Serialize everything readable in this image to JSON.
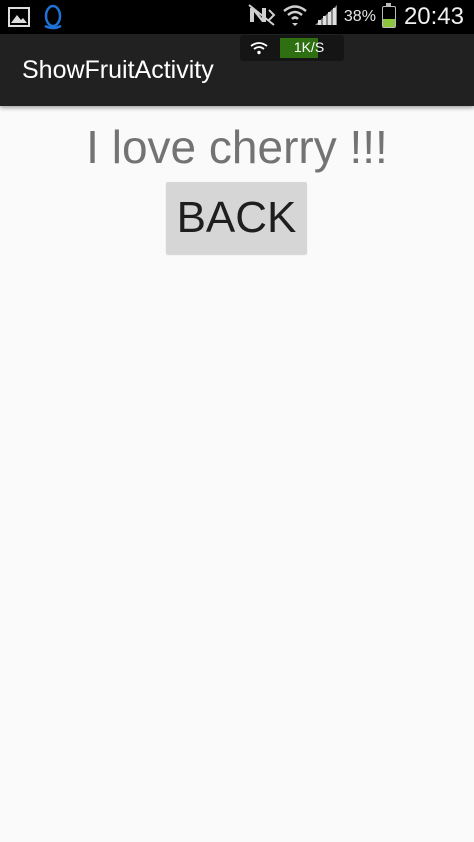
{
  "status_bar": {
    "left_icons": [
      "gallery-icon",
      "qq-penguin-icon"
    ],
    "right_icons": [
      "no-signal-icon",
      "wifi-icon",
      "cell-signal-icon",
      "battery-icon"
    ],
    "battery_percent": "38%",
    "battery_level": 0.38,
    "time": "20:43"
  },
  "network_indicator": {
    "icon": "wifi-icon",
    "speed": "1K/S"
  },
  "action_bar": {
    "title": "ShowFruitActivity",
    "background_color": "#212121"
  },
  "content": {
    "message": "I love cherry !!!",
    "back_button_label": "BACK",
    "background_color": "#fafafa"
  }
}
